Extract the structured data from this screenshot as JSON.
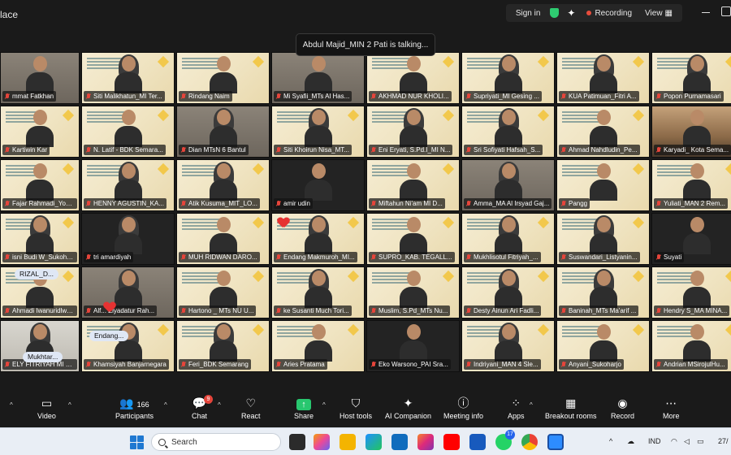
{
  "window": {
    "title": "lace",
    "sign_in": "Sign in",
    "recording": "Recording",
    "view": "View"
  },
  "talking_banner": "Abdul Majid_MIN 2 Pati is talking...",
  "participants_grid": [
    [
      "mmat Fatkhan",
      "Siti Malikhatun_MI Ter...",
      "Rindang Naim",
      "Mi Syafii_MTs Al Has...",
      "AKHMAD NUR KHOLI...",
      "Supriyati_MI Gesing ...",
      "KUA Patimuan_Fitri A...",
      "Popon Purnamasari"
    ],
    [
      "Kartiwin Kar",
      "N. Latif - BDK Semara...",
      "Dian MTsN 6 Bantul",
      "Siti Khoirun Nisa_MT...",
      "Eni Eryati, S.Pd.I_MI N...",
      "Sri Sofiyati Hafsah_S...",
      "Ahmad Nahdludin_Pe...",
      "Karyadi_ Kota Sema..."
    ],
    [
      "Fajar Rahmadi_Yogya...",
      "HENNY AGUSTIN_KA...",
      "Atik Kusuma_MIT_LO...",
      "amir udin",
      "Miftahun Ni'am MI D...",
      "Amma_MA   Al Irsyad Gaj...",
      "Pangg",
      "Yuliati_MAN 2 Rem..."
    ],
    [
      "isni Budi W_Sukoharjo",
      "tri amardiyah",
      "MUH RIDWAN DARO...",
      "Endang Makmuroh_MI...",
      "SUPRO_KAB. TEGALL...",
      "Mukhlisotul Fitriyah_...",
      "Suswandari_Listyanin...",
      "Suyati"
    ],
    [
      "Ahmadi Iwanuridlwan...",
      "Alf... Ziyadatur Rah...",
      "Hartono _ MTs NU U...",
      "ke Susanti Much Tori...",
      "Muslim, S.Pd_MTs Nu...",
      "Desty Ainun Ari Fadli...",
      "Baninah_MTs Ma'arif ...",
      "Hendry S_MA MINA..."
    ],
    [
      "ELY FITRIYAH MI NU J...",
      "Khamsiyah Banjarnegara",
      "Feri_BDK Semarang",
      "Aries Pratama",
      "Eko Warsono_PAI Sra...",
      "Indriyani_MAN 4 Sle...",
      "Anyani_Sukoharjo",
      "Andrian MSirojulHu..."
    ]
  ],
  "floating_labels": {
    "rizal": "RIZAL_D...",
    "endang": "Endang...",
    "mukhtar": "Mukhtar..."
  },
  "toolbar": {
    "video": "Video",
    "participants": "Participants",
    "participants_count": "166",
    "chat": "Chat",
    "chat_badge": "9",
    "react": "React",
    "share": "Share",
    "host_tools": "Host tools",
    "ai_companion": "AI Companion",
    "meeting_info": "Meeting info",
    "apps": "Apps",
    "breakout_rooms": "Breakout rooms",
    "record": "Record",
    "more": "More"
  },
  "taskbar": {
    "search_placeholder": "Search",
    "whatsapp_badge": "17",
    "language": "IND",
    "date": "27/"
  }
}
